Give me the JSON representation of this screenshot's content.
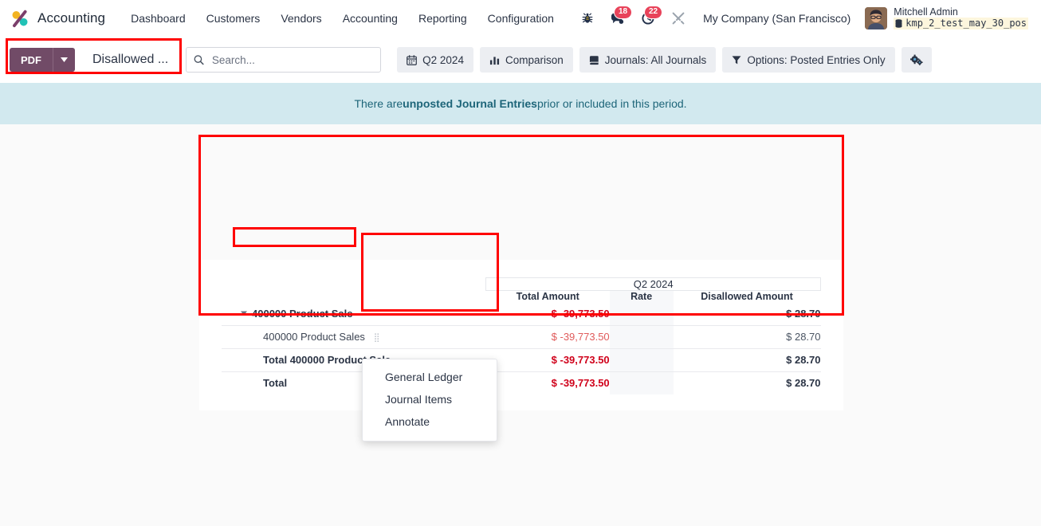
{
  "navbar": {
    "brand": "Accounting",
    "brand_logo_icon": "odoo-accounting-logo-icon",
    "menu": [
      {
        "label": "Dashboard"
      },
      {
        "label": "Customers"
      },
      {
        "label": "Vendors"
      },
      {
        "label": "Accounting"
      },
      {
        "label": "Reporting"
      },
      {
        "label": "Configuration"
      }
    ],
    "systray": {
      "debug_icon": "bug-icon",
      "messages_icon": "chat-bubble-icon",
      "messages_count": "18",
      "activities_icon": "clock-icon",
      "activities_count": "22",
      "tools_icon": "wrench-screwdriver-icon",
      "company": "My Company (San Francisco)",
      "avatar_icon": "user-avatar",
      "user_name": "Mitchell Admin",
      "database_icon": "database-icon",
      "database": "kmp_2_test_may_30_pos"
    }
  },
  "control_panel": {
    "pdf_label": "PDF",
    "pdf_caret_icon": "caret-down-icon",
    "breadcrumb": "Disallowed ...",
    "search": {
      "icon": "search-icon",
      "placeholder": "Search...",
      "value": ""
    },
    "filters": [
      {
        "icon": "calendar-icon",
        "label": "Q2 2024"
      },
      {
        "icon": "bar-chart-icon",
        "label": "Comparison"
      },
      {
        "icon": "book-icon",
        "label": "Journals: All Journals"
      },
      {
        "icon": "funnel-icon",
        "label": "Options: Posted Entries Only"
      }
    ],
    "settings_icon": "cogs-icon"
  },
  "alert": {
    "prefix": "There are ",
    "strong": "unposted Journal Entries",
    "suffix": " prior or included in this period."
  },
  "report": {
    "period_header": "Q2 2024",
    "columns": [
      "Total Amount",
      "Rate",
      "Disallowed Amount"
    ],
    "rows": [
      {
        "name": "400000 Product Sale",
        "level": 0,
        "has_caret": true,
        "has_handle": false,
        "total_amount": "$ -39,773.50",
        "rate": "",
        "disallowed_amount": "$ 28.70",
        "muted": false
      },
      {
        "name": "400000 Product Sales",
        "level": 1,
        "has_caret": false,
        "has_handle": true,
        "total_amount": "$ -39,773.50",
        "rate": "",
        "disallowed_amount": "$ 28.70",
        "muted": true
      },
      {
        "name": "Total 400000 Product Sale",
        "level": 2,
        "has_caret": false,
        "has_handle": false,
        "total_amount": "$ -39,773.50",
        "rate": "",
        "disallowed_amount": "$ 28.70",
        "muted": false
      },
      {
        "name": "Total",
        "level": 2,
        "has_caret": false,
        "has_handle": false,
        "total_amount": "$ -39,773.50",
        "rate": "",
        "disallowed_amount": "$ 28.70",
        "muted": false
      }
    ]
  },
  "popup_menu": {
    "items": [
      {
        "label": "General Ledger"
      },
      {
        "label": "Journal Items"
      },
      {
        "label": "Annotate"
      }
    ]
  },
  "colors": {
    "brand_purple": "#714b67",
    "negative_amount": "#d0021b",
    "alert_bg": "#d2e9ef",
    "alert_text": "#1d6579",
    "badge_red": "#e8435a",
    "annotation_red": "#ff0000"
  }
}
